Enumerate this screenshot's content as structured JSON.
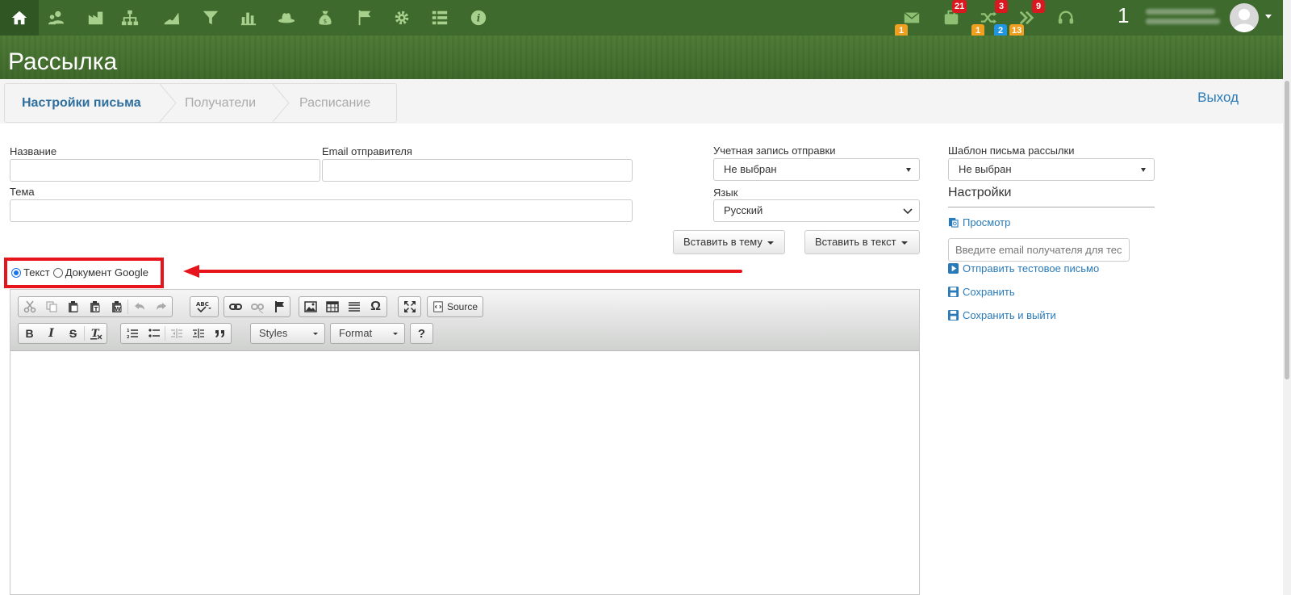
{
  "navbar": {
    "icons": [
      "home-icon",
      "users-icon",
      "factory-icon",
      "org-chart-icon",
      "area-chart-icon",
      "filter-icon",
      "bar-chart-icon",
      "hat-icon",
      "money-bag-icon",
      "flags-icon",
      "gear-icon",
      "list-icon",
      "info-icon"
    ],
    "mail_badge": "1",
    "briefcase_badge": "21",
    "shuffle_badge_top": "3",
    "shuffle_badge_orange": "1",
    "shuffle_badge_blue": "2",
    "forward_badge_top": "9",
    "forward_badge_orange": "13",
    "counter": "1",
    "accent": "#3e6a2d"
  },
  "page": {
    "title": "Рассылка"
  },
  "wizard": {
    "steps": [
      "Настройки письма",
      "Получатели",
      "Расписание"
    ],
    "logout": "Выход"
  },
  "form": {
    "name_label": "Название",
    "sender_email_label": "Email отправителя",
    "subject_label": "Тема",
    "account_label": "Учетная запись отправки",
    "account_value": "Не выбран",
    "language_label": "Язык",
    "language_value": "Русский",
    "insert_subject_btn": "Вставить в тему",
    "insert_text_btn": "Вставить в текст",
    "template_label": "Шаблон письма рассылки",
    "template_value": "Не выбран"
  },
  "content_type": {
    "text_option": "Текст",
    "google_doc_option": "Документ Google",
    "selected": "Текст"
  },
  "editor": {
    "source_label": "Source",
    "styles_label": "Styles",
    "format_label": "Format",
    "help_label": "?"
  },
  "sidebar": {
    "settings_title": "Настройки",
    "preview_link": "Просмотр",
    "test_email_placeholder": "Введите email получателя для тес",
    "send_test_link": "Отправить тестовое письмо",
    "save_link": "Сохранить",
    "save_exit_link": "Сохранить и выйти"
  }
}
